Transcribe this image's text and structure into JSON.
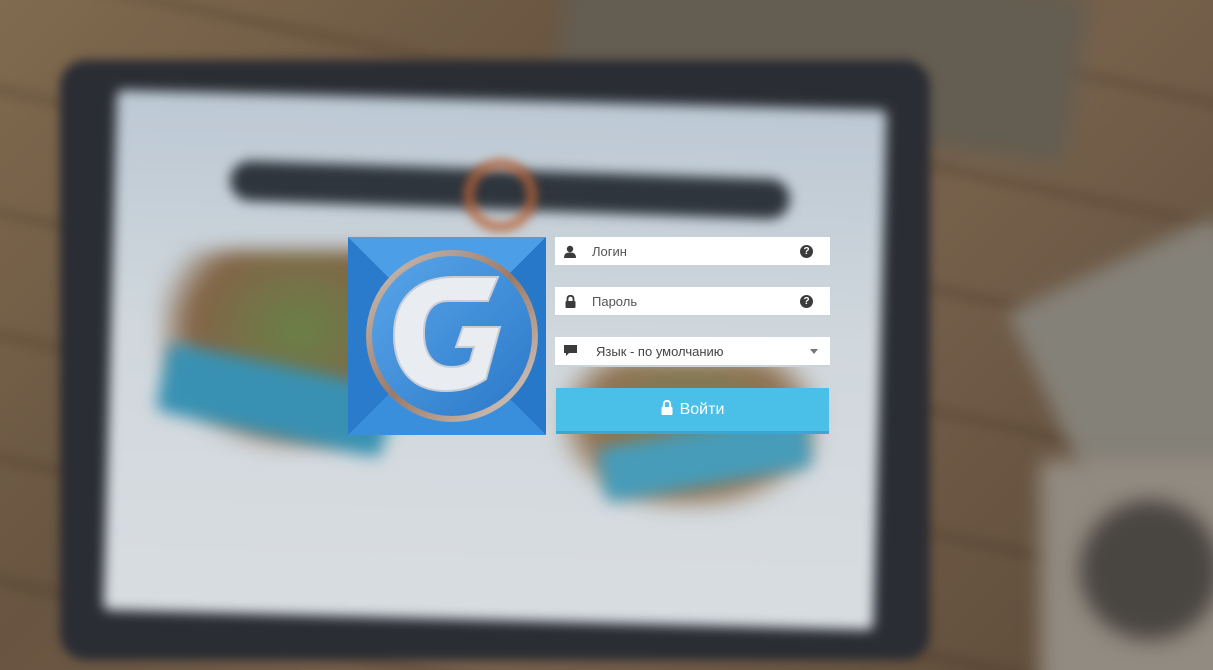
{
  "login_form": {
    "username": {
      "placeholder": "Логин",
      "icon": "user-icon",
      "help_icon": "question-circle-icon"
    },
    "password": {
      "placeholder": "Пароль",
      "icon": "lock-icon",
      "help_icon": "question-circle-icon"
    },
    "language": {
      "selected": "Язык - по умолчанию",
      "icon": "speech-bubble-icon"
    },
    "submit": {
      "label": "Войти",
      "icon": "lock-icon"
    }
  },
  "logo": {
    "letter": "G",
    "icon": "app-logo"
  },
  "colors": {
    "accent": "#4abfe8",
    "logo_blue": "#2f86d6",
    "logo_letter": "#eef1f5",
    "field_bg": "#ffffff",
    "icon_dark": "#3b3b3b"
  }
}
